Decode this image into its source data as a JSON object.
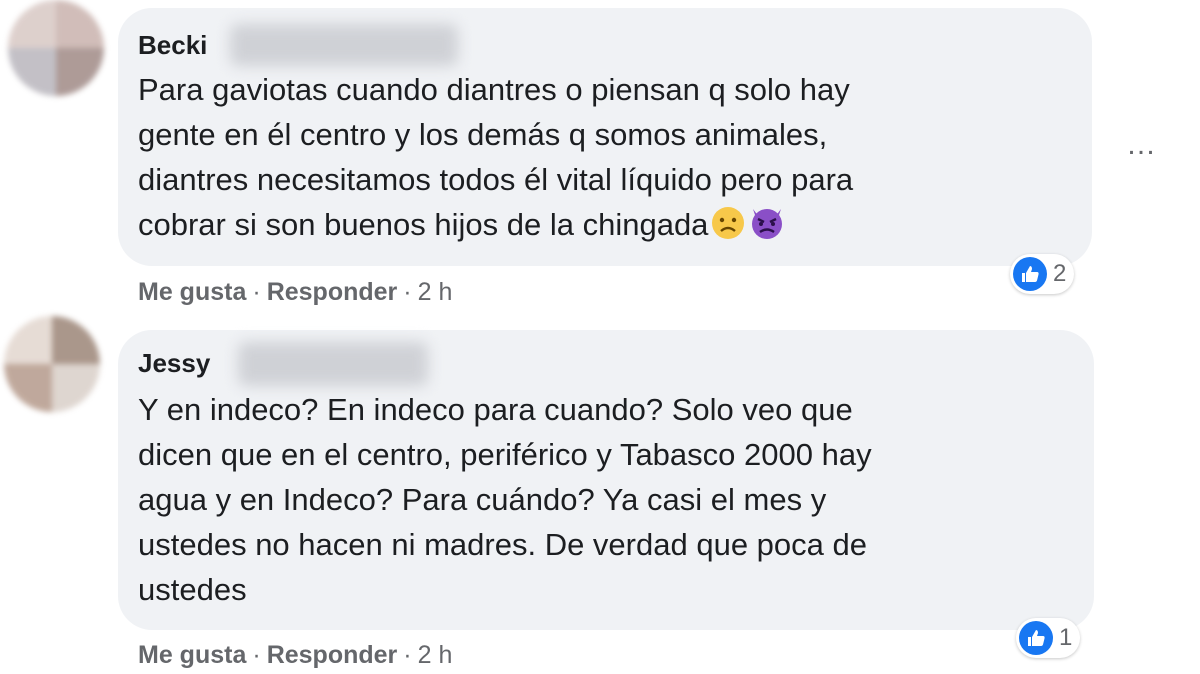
{
  "comments": [
    {
      "author": "Becki",
      "text": "Para gaviotas cuando diantres o piensan q solo hay\ngente en él centro y los demás q somos animales,\ndiantres necesitamos todos él vital líquido pero para\ncobrar si son buenos hijos de la chingada",
      "emojis": [
        "frowning-face-emoji",
        "angry-devil-emoji"
      ],
      "like_label": "Me gusta",
      "separator": "·",
      "reply_label": "Responder",
      "time": "2 h",
      "reaction_count": "2",
      "reaction_icon": "like-icon"
    },
    {
      "author": "Jessy",
      "text": "Y en indeco? En indeco para cuando? Solo veo que\ndicen que en el centro, periférico y Tabasco 2000 hay\nagua y en Indeco? Para cuándo? Ya casi el mes y\nustedes no hacen ni madres. De verdad que poca de\nustedes",
      "like_label": "Me gusta",
      "separator": "·",
      "reply_label": "Responder",
      "time": "2 h",
      "reaction_count": "1",
      "reaction_icon": "like-icon"
    }
  ],
  "more_button": "…",
  "colors": {
    "bubble": "#f0f2f5",
    "like_blue": "#1877f2",
    "secondary_text": "#65676b"
  }
}
